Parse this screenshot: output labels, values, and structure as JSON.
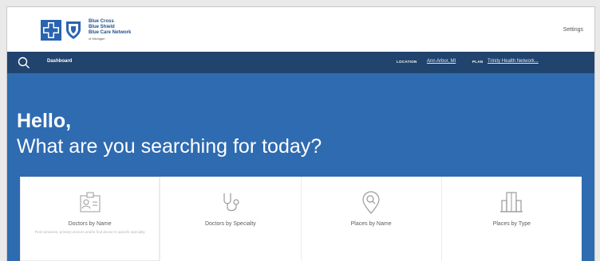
{
  "brand": {
    "logo_line1": "Blue Cross",
    "logo_line2": "Blue Shield",
    "logo_line3": "Blue Care Network",
    "logo_line4": "of Michigan"
  },
  "header": {
    "settings_label": "Settings"
  },
  "nav": {
    "dashboard_label": "Dashboard",
    "location_label": "LOCATION",
    "location_value": "Ann Arbor, MI",
    "plan_label": "PLAN",
    "plan_value": "Trinity Health Network..."
  },
  "hero": {
    "greeting": "Hello,",
    "question": "What are you searching for today?"
  },
  "search_cards": [
    {
      "label": "Doctors by Name",
      "description": "Find someone, primary doctors and/or find doctor in specific specialty",
      "icon": "id-card-icon"
    },
    {
      "label": "Doctors by Specialty",
      "description": "",
      "icon": "stethoscope-icon"
    },
    {
      "label": "Places by Name",
      "description": "",
      "icon": "location-search-icon"
    },
    {
      "label": "Places by Type",
      "description": "",
      "icon": "building-icon"
    }
  ],
  "colors": {
    "navbar": "#21446e",
    "hero": "#2f6bb0",
    "card": "#ffffff"
  }
}
